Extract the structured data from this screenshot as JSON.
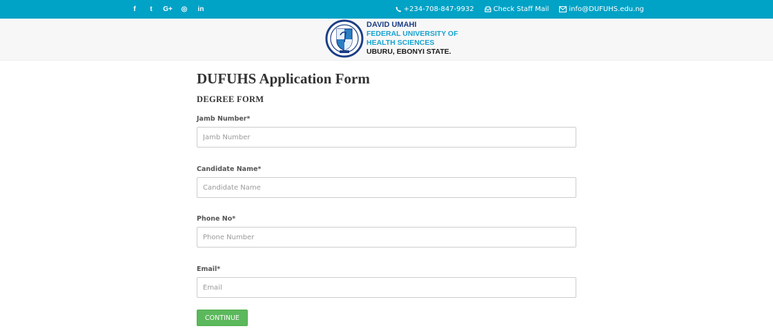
{
  "topbar": {
    "social": [
      {
        "icon": "facebook-icon",
        "glyph": "f"
      },
      {
        "icon": "twitter-icon",
        "glyph": "t"
      },
      {
        "icon": "google-plus-icon",
        "glyph": "G+"
      },
      {
        "icon": "instagram-icon",
        "glyph": "◎"
      },
      {
        "icon": "linkedin-icon",
        "glyph": "in"
      }
    ],
    "phone": "+234-708-847-9932",
    "staff_mail": "Check Staff Mail",
    "email": "info@DUFUHS.edu.ng",
    "background_color": "#00a2c6"
  },
  "header": {
    "brand_line1": "DAVID UMAHI",
    "brand_line2": "FEDERAL UNIVERSITY OF",
    "brand_line3": "HEALTH SCIENCES",
    "brand_line4": "UBURU, EBONYI STATE."
  },
  "form": {
    "title": "DUFUHS Application Form",
    "subtitle": "DEGREE FORM",
    "fields": [
      {
        "label": "Jamb Number*",
        "placeholder": "Jamb Number",
        "value": ""
      },
      {
        "label": "Candidate Name*",
        "placeholder": "Candidate Name",
        "value": ""
      },
      {
        "label": "Phone No*",
        "placeholder": "Phone Number",
        "value": ""
      },
      {
        "label": "Email*",
        "placeholder": "Email",
        "value": ""
      }
    ],
    "continue_label": "CONTINUE",
    "button_color": "#5cb85c"
  }
}
